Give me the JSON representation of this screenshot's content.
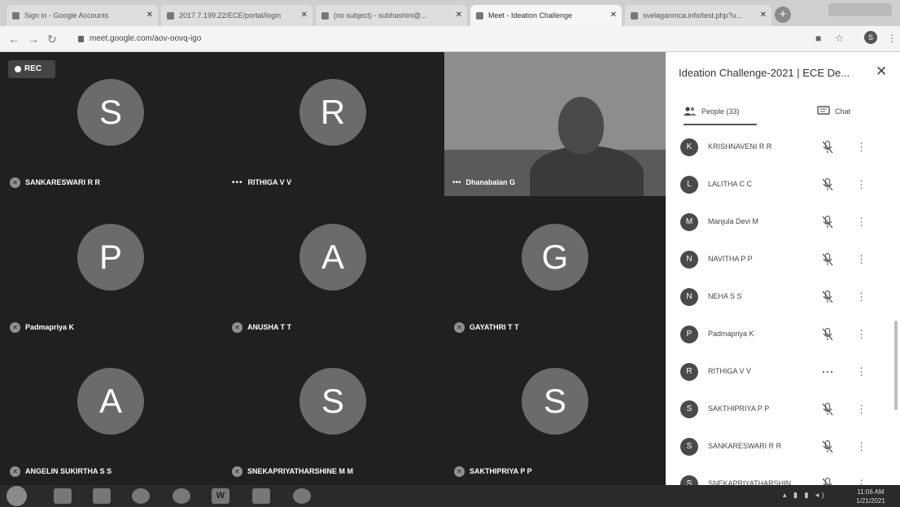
{
  "browser": {
    "tabs": [
      {
        "label": "Sign in - Google Accounts",
        "active": false
      },
      {
        "label": "2017.7.199.22/ECE/portal/login",
        "active": false
      },
      {
        "label": "(no subject) - subhashini@...",
        "active": false
      },
      {
        "label": "Meet - Ideation Challenge",
        "active": true
      },
      {
        "label": "svelaganmca.info/test.php?u...",
        "active": false
      }
    ],
    "new_tab": "+",
    "url": "meet.google.com/aov-oovq-igo",
    "profile_initial": "S"
  },
  "meeting": {
    "rec_label": "REC",
    "tiles": [
      {
        "initial": "S",
        "name": "SANKARESWARI R R",
        "status": "muted"
      },
      {
        "initial": "R",
        "name": "RITHIGA V V",
        "status": "speaking"
      },
      {
        "initial": "P",
        "name": "Padmapriya K",
        "status": "muted"
      },
      {
        "initial": "A",
        "name": "ANUSHA T T",
        "status": "muted"
      },
      {
        "initial": "G",
        "name": "GAYATHRI T T",
        "status": "muted"
      },
      {
        "initial": "A",
        "name": "ANGELIN SUKIRTHA S S",
        "status": "muted"
      },
      {
        "initial": "S",
        "name": "SNEKAPRIYATHARSHINE M M",
        "status": "muted"
      },
      {
        "initial": "S",
        "name": "SAKTHIPRIYA P P",
        "status": "muted"
      }
    ],
    "video_tile": {
      "name": "Dhanabalan G",
      "status": "speaking"
    }
  },
  "panel": {
    "title": "Ideation Challenge-2021 | ECE De...",
    "close_icon": "close-icon",
    "tabs": {
      "people": "People (33)",
      "chat": "Chat"
    },
    "participants": [
      {
        "initial": "K",
        "name": "KRISHNAVENI R R",
        "status": "muted"
      },
      {
        "initial": "L",
        "name": "LALITHA C C",
        "status": "muted"
      },
      {
        "initial": "M",
        "name": "Manjula Devi M",
        "status": "muted"
      },
      {
        "initial": "N",
        "name": "NAVITHA P P",
        "status": "muted"
      },
      {
        "initial": "N",
        "name": "NEHA S S",
        "status": "muted"
      },
      {
        "initial": "P",
        "name": "Padmapriya K",
        "status": "muted"
      },
      {
        "initial": "R",
        "name": "RITHIGA V V",
        "status": "speaking"
      },
      {
        "initial": "S",
        "name": "SAKTHIPRIYA P P",
        "status": "muted"
      },
      {
        "initial": "S",
        "name": "SANKARESWARI R R",
        "status": "muted"
      },
      {
        "initial": "S",
        "name": "SNEKAPRIYATHARSHIN...",
        "status": "muted"
      }
    ]
  },
  "taskbar": {
    "apps": [
      "explorer",
      "media",
      "chrome",
      "firefox",
      "W",
      "mail",
      "paint"
    ],
    "time": "11:06 AM",
    "date": "1/21/2021"
  }
}
